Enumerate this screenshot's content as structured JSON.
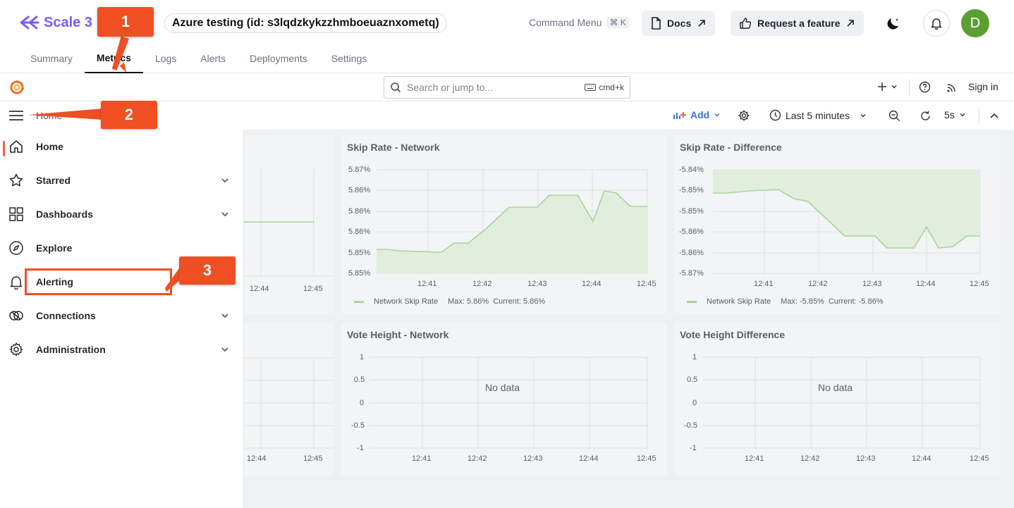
{
  "app": {
    "brand": "Scale 3",
    "project_title": "Azure testing (id: s3lqdzkykzzhmboeuaznxometq)",
    "command_menu": "Command Menu",
    "command_shortcut": "⌘ K",
    "docs_label": "Docs",
    "feature_label": "Request a feature",
    "avatar_initial": "D",
    "tabs": [
      "Summary",
      "Metrics",
      "Logs",
      "Alerts",
      "Deployments",
      "Settings"
    ],
    "active_tab": "Metrics"
  },
  "grafana": {
    "search_placeholder": "Search or jump to...",
    "search_shortcut": "cmd+k",
    "sign_in": "Sign in",
    "breadcrumb": "Home",
    "add_label": "Add",
    "time_range": "Last 5 minutes",
    "refresh_interval": "5s"
  },
  "side_menu": {
    "items": [
      {
        "label": "Home",
        "icon": "home-icon",
        "expandable": false,
        "active": true
      },
      {
        "label": "Starred",
        "icon": "star-icon",
        "expandable": true
      },
      {
        "label": "Dashboards",
        "icon": "dashboards-icon",
        "expandable": true
      },
      {
        "label": "Explore",
        "icon": "compass-icon",
        "expandable": false
      },
      {
        "label": "Alerting",
        "icon": "bell-icon",
        "expandable": false
      },
      {
        "label": "Connections",
        "icon": "connections-icon",
        "expandable": true
      },
      {
        "label": "Administration",
        "icon": "cog-icon",
        "expandable": true
      }
    ]
  },
  "panels": {
    "skip_network": {
      "title": "Skip Rate - Network",
      "y_ticks": [
        "5.87%",
        "5.86%",
        "5.86%",
        "5.86%",
        "5.85%",
        "5.85%"
      ],
      "x_ticks": [
        "12:41",
        "12:42",
        "12:43",
        "12:44",
        "12:45"
      ],
      "legend": "Network Skip Rate",
      "legend_max": "Max: 5.86%",
      "legend_current": "Current: 5.86%"
    },
    "skip_diff": {
      "title": "Skip Rate - Difference",
      "y_ticks": [
        "-5.84%",
        "-5.85%",
        "-5.85%",
        "-5.86%",
        "-5.86%",
        "-5.87%"
      ],
      "x_ticks": [
        "12:41",
        "12:42",
        "12:43",
        "12:44",
        "12:45"
      ],
      "legend": "Network Skip Rate",
      "legend_max": "Max: -5.85%",
      "legend_current": "Current: -5.86%"
    },
    "vote_network": {
      "title": "Vote Height - Network",
      "y_ticks": [
        "1",
        "0.5",
        "0",
        "-0.5",
        "-1"
      ],
      "x_ticks": [
        "12:41",
        "12:42",
        "12:43",
        "12:44",
        "12:45"
      ],
      "no_data": "No data"
    },
    "vote_diff": {
      "title": "Vote Height Difference",
      "y_ticks": [
        "1",
        "0.5",
        "0",
        "-0.5",
        "-1"
      ],
      "x_ticks": [
        "12:41",
        "12:42",
        "12:43",
        "12:44",
        "12:45"
      ],
      "no_data": "No data"
    },
    "left_top_x": [
      "12:44",
      "12:45"
    ],
    "left_bottom_x": [
      "12:44",
      "12:45"
    ]
  },
  "annotations": {
    "badge1": "1",
    "badge2": "2",
    "badge3": "3"
  },
  "colors": {
    "brand": "#7c5cf6",
    "annotation": "#f04e23",
    "series": "#9dd08f",
    "avatar": "#5c9e31"
  }
}
